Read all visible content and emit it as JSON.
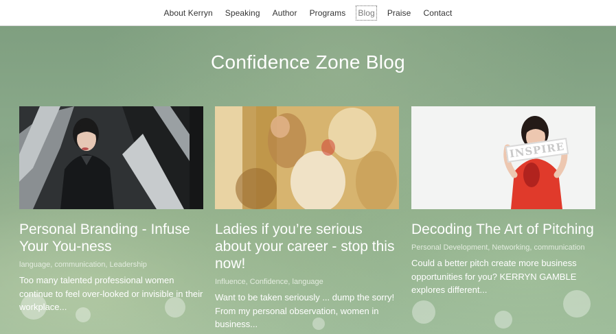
{
  "nav": {
    "items": [
      {
        "label": "About Kerryn"
      },
      {
        "label": "Speaking"
      },
      {
        "label": "Author"
      },
      {
        "label": "Programs"
      },
      {
        "label": "Blog"
      },
      {
        "label": "Praise"
      },
      {
        "label": "Contact"
      }
    ],
    "active": "Blog"
  },
  "hero": {
    "title": "Confidence Zone Blog"
  },
  "posts": [
    {
      "title": "Personal Branding - Infuse Your You-ness",
      "tags": "language, communication, Leadership",
      "excerpt": "Too many talented professional women continue to feel over-looked or invisible in their workplace..."
    },
    {
      "title": "Ladies if you’re serious about your career - stop this now!",
      "tags": "Influence, Confidence, language",
      "excerpt": "Want to be taken seriously ... dump the sorry! From my personal observation, women in business..."
    },
    {
      "title": "Decoding The Art of Pitching",
      "tags": "Personal Development, Networking, communication",
      "excerpt": "Could a better pitch create more business opportunities for you? KERRYN GAMBLE explores different..."
    }
  ],
  "post3_sign_text": "INSPIRE",
  "colors": {
    "hero_green": "#86a585",
    "card_text": "#ffffff",
    "accent_red": "#e03a2b"
  }
}
